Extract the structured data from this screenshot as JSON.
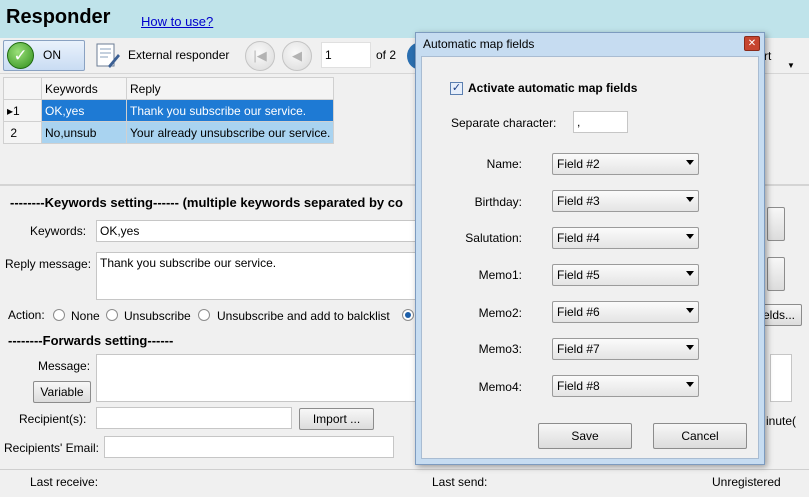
{
  "header": {
    "title": "Responder",
    "howto": "How to use?"
  },
  "toolbar": {
    "on_label": "ON",
    "external_label": "External responder",
    "page_value": "1",
    "of_label": "of 2",
    "right_label": "rt"
  },
  "grid": {
    "columns": [
      "Keywords",
      "Reply"
    ],
    "rows": [
      {
        "num": "1",
        "keywords": "OK,yes",
        "reply": "Thank you subscribe our service."
      },
      {
        "num": "2",
        "keywords": "No,unsub",
        "reply": "Your already unsubscribe our service."
      }
    ]
  },
  "keywords_setting": {
    "title": "--------Keywords setting------ (multiple keywords separated by co",
    "keywords_label": "Keywords:",
    "keywords_value": "OK,yes",
    "reply_label": "Reply message:",
    "reply_value": "Thank you subscribe our service.",
    "action_label": "Action:",
    "actions": [
      "None",
      "Unsubscribe",
      "Unsubscribe and add to balcklist"
    ],
    "fields_button": "elds..."
  },
  "forwards_setting": {
    "title": "--------Forwards setting------",
    "message_label": "Message:",
    "variable_button": "Variable",
    "recipients_label": "Recipient(s):",
    "import_button": "Import ...",
    "email_label": "Recipients' Email:",
    "minute_label": "inute("
  },
  "status": {
    "last_receive": "Last receive:",
    "last_send": "Last send:",
    "registration": "Unregistered"
  },
  "dialog": {
    "title": "Automatic map fields",
    "close_icon": "close-icon",
    "activate_label": "Activate automatic map  fields",
    "activate_checked": true,
    "separator_label": "Separate character:",
    "separator_value": ",",
    "mappings": [
      {
        "label": "Name:",
        "value": "Field #2"
      },
      {
        "label": "Birthday:",
        "value": "Field #3"
      },
      {
        "label": "Salutation:",
        "value": "Field #4"
      },
      {
        "label": "Memo1:",
        "value": "Field #5"
      },
      {
        "label": "Memo2:",
        "value": "Field #6"
      },
      {
        "label": "Memo3:",
        "value": "Field #7"
      },
      {
        "label": "Memo4:",
        "value": "Field #8"
      }
    ],
    "save_button": "Save",
    "cancel_button": "Cancel"
  },
  "colors": {
    "header_bg": "#bfe3ea",
    "selected_row": "#1e7ad4",
    "dialog_frame": "#c6dcf1",
    "link": "#0000cc"
  }
}
